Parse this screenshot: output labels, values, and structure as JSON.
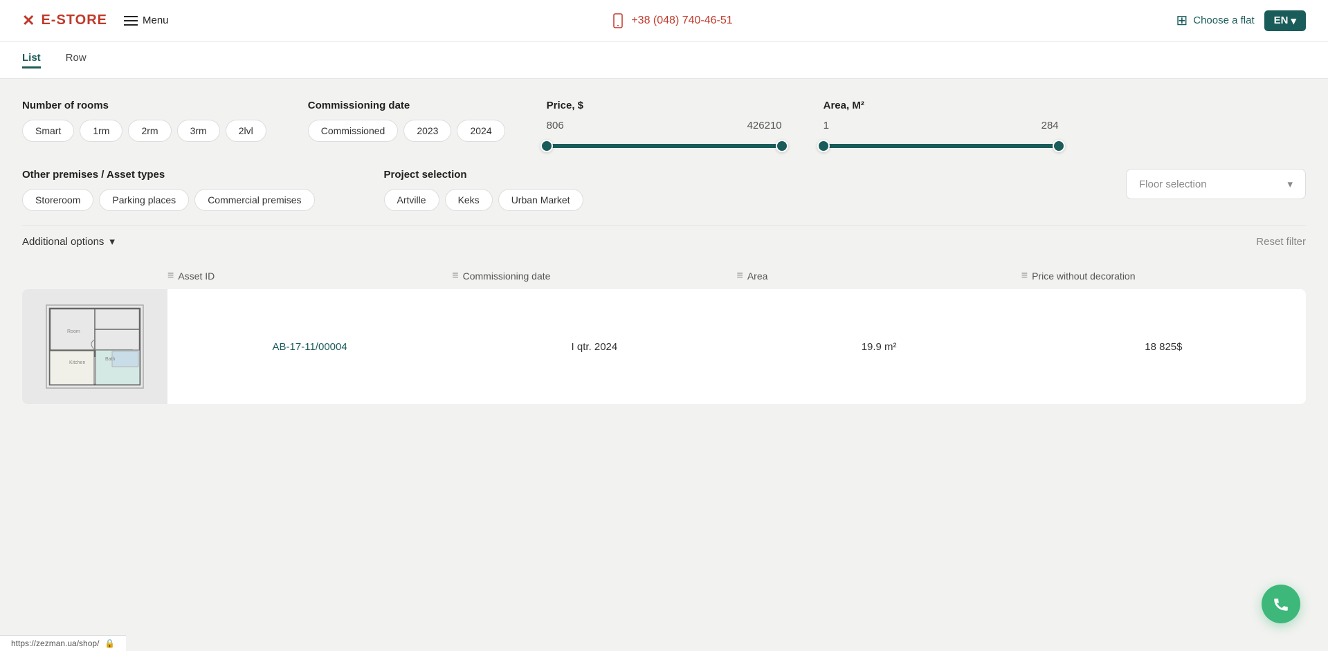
{
  "header": {
    "logo_text": "E-STORE",
    "menu_label": "Menu",
    "phone": "+38 (048) 740-46-51",
    "choose_flat_label": "Choose a flat",
    "lang": "EN"
  },
  "view_toggle": {
    "tabs": [
      {
        "id": "list",
        "label": "List",
        "active": true
      },
      {
        "id": "row",
        "label": "Row",
        "active": false
      }
    ]
  },
  "filters": {
    "rooms": {
      "label": "Number of rooms",
      "options": [
        "Smart",
        "1rm",
        "2rm",
        "3rm",
        "2lvl"
      ]
    },
    "commissioning": {
      "label": "Commissioning date",
      "options": [
        "Commissioned",
        "2023",
        "2024"
      ]
    },
    "price": {
      "label": "Price, $",
      "min": "806",
      "max": "426210",
      "fill_left": "0%",
      "fill_right": "100%"
    },
    "area": {
      "label": "Area, M²",
      "min": "1",
      "max": "284",
      "fill_left": "0%",
      "fill_right": "100%"
    },
    "other_premises": {
      "label": "Other premises / Asset types",
      "options": [
        "Storeroom",
        "Parking places",
        "Commercial premises"
      ]
    },
    "project": {
      "label": "Project selection",
      "options": [
        "Artville",
        "Keks",
        "Urban Market"
      ]
    },
    "floor": {
      "label": "Floor selection",
      "placeholder": "Floor selection"
    },
    "additional": {
      "label": "Additional options",
      "reset_label": "Reset filter"
    }
  },
  "table": {
    "columns": [
      {
        "id": "asset_id",
        "label": "Asset ID"
      },
      {
        "id": "commissioning_date",
        "label": "Commissioning date"
      },
      {
        "id": "area",
        "label": "Area"
      },
      {
        "id": "price",
        "label": "Price without decoration"
      }
    ],
    "rows": [
      {
        "id": "row-1",
        "asset_id": "AB-17-11/00004",
        "commissioning_date": "I qtr. 2024",
        "area": "19.9 m²",
        "price": "18 825$"
      }
    ]
  },
  "status_bar": {
    "url": "https://zezman.ua/shop/"
  }
}
